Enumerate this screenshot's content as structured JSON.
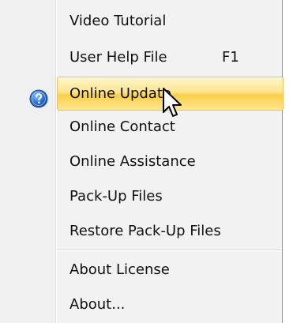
{
  "menu": {
    "items": [
      {
        "label": "Video Tutorial"
      },
      {
        "label": "User Help File",
        "shortcut": "F1",
        "icon": "help-icon"
      },
      {
        "label": "Online Update",
        "state": "highlighted"
      },
      {
        "label": "Online Contact"
      },
      {
        "label": "Online Assistance"
      },
      {
        "label": "Pack-Up Files"
      },
      {
        "label": "Restore Pack-Up Files"
      },
      {
        "label": "About License"
      },
      {
        "label": "About..."
      }
    ]
  },
  "colors": {
    "menu_background": "#f2f2f2",
    "highlight_top": "#fff6cf",
    "highlight_bottom": "#fbce4a",
    "highlight_border": "#e5c365",
    "help_icon_blue": "#2a6fd0"
  }
}
